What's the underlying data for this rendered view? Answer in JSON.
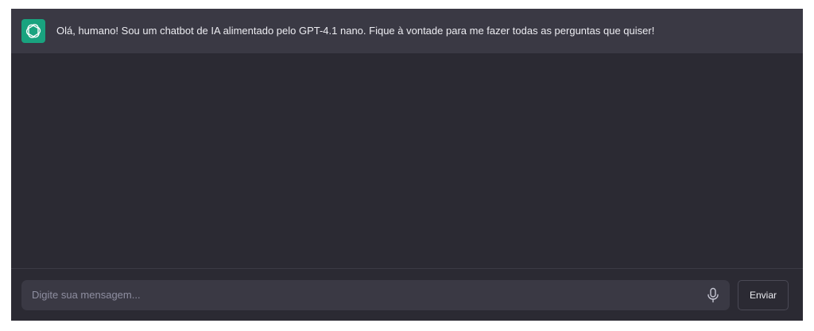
{
  "chat": {
    "bot": {
      "avatar_icon": "openai-logo-icon",
      "avatar_color": "#19a37f",
      "message": "Olá, humano! Sou um chatbot de IA alimentado pelo GPT-4.1 nano. Fique à vontade para me fazer todas as perguntas que quiser!"
    }
  },
  "composer": {
    "input_value": "",
    "input_placeholder": "Digite sua mensagem...",
    "mic_icon": "microphone-icon",
    "send_label": "Enviar"
  },
  "colors": {
    "window_bg": "#2b2a33",
    "message_row_bg": "#3a3944",
    "text": "#ececf1",
    "placeholder": "#8e8ea0"
  }
}
